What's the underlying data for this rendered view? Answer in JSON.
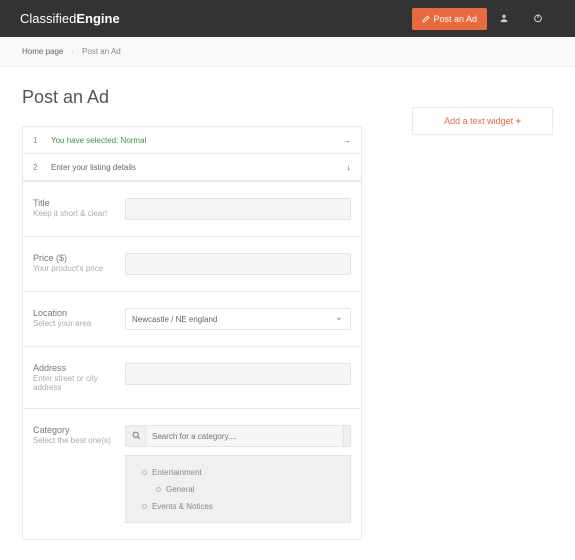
{
  "brand": {
    "part1": "Classified",
    "part2": "Engine"
  },
  "header": {
    "post_ad": "Post an Ad"
  },
  "breadcrumb": {
    "home": "Home page",
    "current": "Post an Ad"
  },
  "page": {
    "title": "Post an Ad"
  },
  "steps": {
    "s1": {
      "num": "1",
      "label": "You have selected: Normal"
    },
    "s2": {
      "num": "2",
      "label": "Enter your listing details"
    }
  },
  "fields": {
    "title": {
      "label": "Title",
      "hint": "Keep it short & clear!"
    },
    "price": {
      "label": "Price ($)",
      "hint": "Your product's price"
    },
    "location": {
      "label": "Location",
      "hint": "Select your area",
      "value": "Newcastle / NE england"
    },
    "address": {
      "label": "Address",
      "hint": "Enter street or city address"
    },
    "category": {
      "label": "Category",
      "hint": "Select the best one(s)",
      "search_placeholder": "Search for a category...."
    }
  },
  "categories": {
    "c0": "Entertainment",
    "c1": "General",
    "c2": "Events & Notices"
  },
  "sidebar": {
    "add_widget": "Add a text widget",
    "plus": "+"
  }
}
